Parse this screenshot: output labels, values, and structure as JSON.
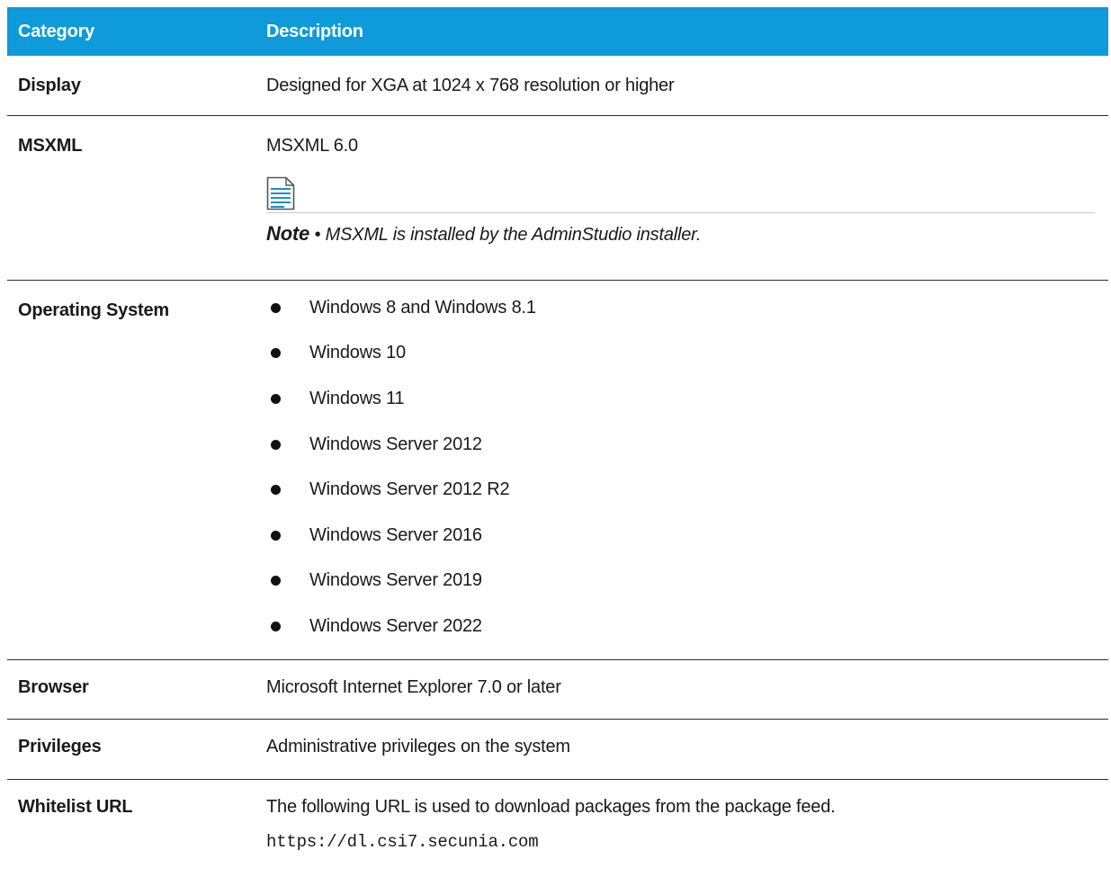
{
  "table": {
    "headers": {
      "category": "Category",
      "description": "Description"
    },
    "display": {
      "category": "Display",
      "text": "Designed for XGA at 1024 x 768 resolution or higher"
    },
    "msxml": {
      "category": "MSXML",
      "text": "MSXML 6.0",
      "note_icon": "document-note-icon",
      "note_label": "Note",
      "note_sep": " • ",
      "note_text": "MSXML is installed by the AdminStudio installer."
    },
    "os": {
      "category": "Operating System",
      "items": [
        "Windows 8 and Windows 8.1",
        "Windows 10",
        "Windows 11",
        "Windows Server 2012",
        "Windows Server 2012 R2",
        "Windows Server 2016",
        "Windows Server 2019",
        "Windows Server 2022"
      ]
    },
    "browser": {
      "category": "Browser",
      "text": "Microsoft Internet Explorer 7.0 or later"
    },
    "privileges": {
      "category": "Privileges",
      "text": "Administrative privileges on the system"
    },
    "whitelist": {
      "category": "Whitelist URL",
      "text": "The following URL is used to download packages from the package feed.",
      "url": "https://dl.csi7.secunia.com"
    }
  },
  "colors": {
    "header_bg": "#0f9ad9",
    "header_text": "#ffffff",
    "rule": "#2b2b2b",
    "note_icon_blue": "#1a8fd0"
  }
}
